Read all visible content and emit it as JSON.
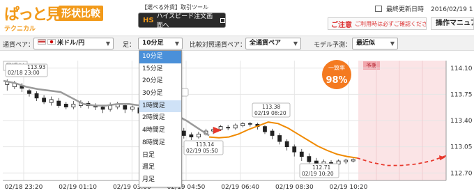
{
  "header": {
    "logo_main": "ぱっと見",
    "logo_sub": "形状比較",
    "logo_tech": "テクニカル",
    "tool_label": "【選べる外貨】取引ツール",
    "tool_button": "ハイスピード注文画面へ",
    "tool_button_mark": "HS",
    "update_label": "最終更新日時",
    "update_date": "2016/02/19 1",
    "caution_title": "ご注意",
    "caution_text": "ご利用時は必ずご確認ください",
    "manual_label": "操作マニュア"
  },
  "controls": {
    "pair_label": "通貨ペア：",
    "pair_value": "米ドル/円",
    "foot_label": "足：",
    "foot_value": "10分足",
    "compare_label": "比較対照通貨ペア：",
    "compare_value": "全通貨ペア",
    "model_label": "モデル予測：",
    "model_value": "最近似",
    "foot_options": [
      "10分足",
      "15分足",
      "20分足",
      "30分足",
      "1時間足",
      "2時間足",
      "4時間足",
      "8時間足",
      "日足",
      "週足",
      "月足"
    ]
  },
  "colors": {
    "accent": "#f29a1a",
    "forecast": "#e8382c",
    "nearest": "#f08a00"
  },
  "chart": {
    "legend_label": "最近似",
    "forecast_label": "予想",
    "match_label": "一致率",
    "match_value": "98%",
    "y_ticks": [
      "114.10",
      "113.75",
      "113.40",
      "113.05",
      "112.70"
    ],
    "x_ticks": [
      "02/18 23:20",
      "02/19 01:10",
      "02/19 03:00",
      "02/19 04:50",
      "02/19 06:40",
      "02/19 08:30",
      "02/19 10:20"
    ],
    "callouts": [
      {
        "price": "113.93",
        "time": "02/18 23:00"
      },
      {
        "price": "113.38",
        "time": "02/19 08:20"
      },
      {
        "price": "113.14",
        "time": "02/19 05:50"
      },
      {
        "price": "112.71",
        "time": "02/19 10:20"
      }
    ],
    "partial_tick": ".0"
  },
  "chart_data": {
    "type": "candlestick",
    "ylim": [
      112.6,
      114.2
    ],
    "grid": true,
    "past_line": [
      [
        0,
        113.93
      ],
      [
        1,
        113.9
      ],
      [
        2,
        113.85
      ],
      [
        3,
        113.82
      ],
      [
        4,
        113.8
      ],
      [
        5,
        113.78
      ],
      [
        6,
        113.7
      ],
      [
        7,
        113.62
      ],
      [
        8,
        113.6
      ],
      [
        9,
        113.6
      ],
      [
        10,
        113.62
      ],
      [
        11,
        113.62
      ],
      [
        12,
        113.6
      ],
      [
        13,
        113.6
      ],
      [
        14,
        113.55
      ],
      [
        15,
        113.48
      ],
      [
        16,
        113.4
      ],
      [
        17,
        113.3
      ],
      [
        18,
        113.2
      ]
    ],
    "near_line": [
      [
        18,
        113.18
      ],
      [
        19,
        113.17
      ],
      [
        20,
        113.18
      ],
      [
        21,
        113.22
      ],
      [
        22,
        113.28
      ],
      [
        23,
        113.33
      ],
      [
        24,
        113.38
      ],
      [
        25,
        113.36
      ],
      [
        26,
        113.3
      ],
      [
        27,
        113.22
      ],
      [
        28,
        113.14
      ],
      [
        29,
        113.06
      ],
      [
        30,
        113.0
      ],
      [
        31,
        112.95
      ],
      [
        32,
        112.92
      ],
      [
        33,
        112.9
      ]
    ],
    "forecast_line": [
      [
        33,
        112.9
      ],
      [
        35,
        112.84
      ],
      [
        37,
        112.8
      ],
      [
        39,
        112.8
      ],
      [
        41,
        112.82
      ],
      [
        43,
        112.86
      ],
      [
        45,
        112.93
      ]
    ],
    "candles": [
      [
        113.88,
        113.92,
        113.8,
        113.95
      ],
      [
        113.85,
        113.9,
        113.82,
        113.93
      ],
      [
        113.86,
        113.83,
        113.78,
        113.9
      ],
      [
        113.8,
        113.76,
        113.72,
        113.82
      ],
      [
        113.76,
        113.7,
        113.66,
        113.79
      ],
      [
        113.7,
        113.65,
        113.62,
        113.74
      ],
      [
        113.64,
        113.68,
        113.6,
        113.72
      ],
      [
        113.66,
        113.6,
        113.57,
        113.7
      ],
      [
        113.62,
        113.58,
        113.55,
        113.65
      ],
      [
        113.58,
        113.62,
        113.55,
        113.66
      ],
      [
        113.6,
        113.64,
        113.57,
        113.67
      ],
      [
        113.63,
        113.6,
        113.56,
        113.66
      ],
      [
        113.6,
        113.58,
        113.54,
        113.63
      ],
      [
        113.58,
        113.55,
        113.5,
        113.61
      ],
      [
        113.55,
        113.6,
        113.52,
        113.64
      ],
      [
        113.58,
        113.62,
        113.55,
        113.65
      ],
      [
        113.6,
        113.55,
        113.5,
        113.63
      ],
      [
        113.55,
        113.58,
        113.52,
        113.6
      ],
      [
        113.57,
        113.5,
        113.46,
        113.6
      ],
      [
        113.5,
        113.53,
        113.45,
        113.56
      ],
      [
        113.52,
        113.47,
        113.43,
        113.55
      ],
      [
        113.46,
        113.4,
        113.36,
        113.5
      ],
      [
        113.4,
        113.32,
        113.28,
        113.44
      ],
      [
        113.32,
        113.25,
        113.2,
        113.36
      ],
      [
        113.26,
        113.2,
        113.16,
        113.3
      ],
      [
        113.21,
        113.18,
        113.14,
        113.24
      ],
      [
        113.18,
        113.22,
        113.16,
        113.25
      ],
      [
        113.22,
        113.26,
        113.2,
        113.29
      ],
      [
        113.26,
        113.28,
        113.22,
        113.31
      ],
      [
        113.28,
        113.32,
        113.26,
        113.34
      ],
      [
        113.31,
        113.3,
        113.27,
        113.34
      ],
      [
        113.3,
        113.34,
        113.28,
        113.36
      ],
      [
        113.33,
        113.36,
        113.31,
        113.38
      ],
      [
        113.36,
        113.35,
        113.32,
        113.38
      ],
      [
        113.35,
        113.32,
        113.28,
        113.37
      ],
      [
        113.32,
        113.25,
        113.22,
        113.34
      ],
      [
        113.26,
        113.2,
        113.15,
        113.29
      ],
      [
        113.2,
        113.12,
        113.08,
        113.23
      ],
      [
        113.12,
        113.05,
        113.0,
        113.15
      ],
      [
        113.05,
        112.98,
        112.92,
        113.08
      ],
      [
        112.98,
        112.92,
        112.86,
        113.02
      ],
      [
        112.92,
        112.85,
        112.78,
        112.96
      ],
      [
        112.86,
        112.8,
        112.71,
        112.9
      ],
      [
        112.8,
        112.85,
        112.75,
        112.88
      ],
      [
        112.84,
        112.82,
        112.78,
        112.87
      ],
      [
        112.82,
        112.86,
        112.8,
        112.88
      ],
      [
        112.85,
        112.87,
        112.82,
        112.89
      ],
      [
        112.86,
        112.88,
        112.84,
        112.9
      ]
    ]
  }
}
